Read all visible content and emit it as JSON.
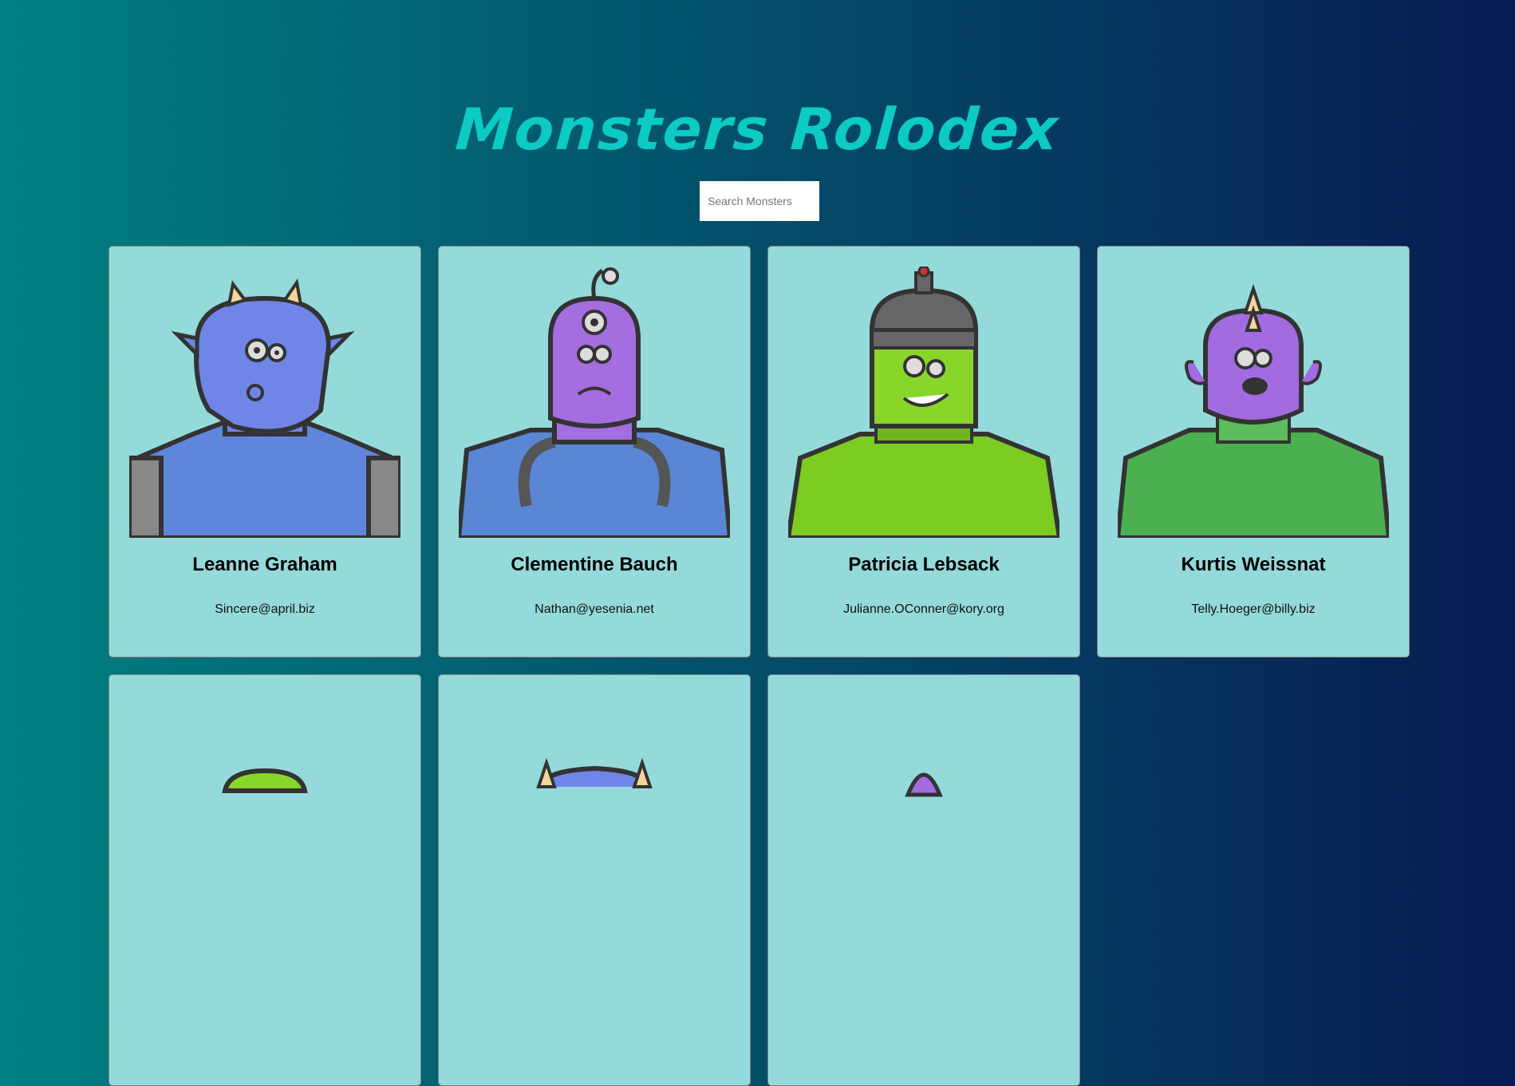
{
  "app": {
    "title": "Monsters Rolodex"
  },
  "search": {
    "placeholder": "Search Monsters",
    "value": ""
  },
  "monsters": [
    {
      "name": "Leanne Graham",
      "email": "Sincere@april.biz",
      "skin": "#6f86e8",
      "body": "#5f86dc",
      "accent": "#f1d59a",
      "type": "horns"
    },
    {
      "name": "Clementine Bauch",
      "email": "Nathan@yesenia.net",
      "skin": "#a46de0",
      "body": "#5a86d6",
      "accent": "#9a9a9a",
      "type": "cyclops"
    },
    {
      "name": "Patricia Lebsack",
      "email": "Julianne.OConner@kory.org",
      "skin": "#88d62a",
      "body": "#7ccc22",
      "accent": "#5d5d5d",
      "type": "helmet"
    },
    {
      "name": "Kurtis Weissnat",
      "email": "Telly.Hoeger@billy.biz",
      "skin": "#a26be0",
      "body": "#4caf50",
      "accent": "#f1d59a",
      "type": "spikes"
    },
    {
      "name": "",
      "email": "",
      "skin": "#88d62a",
      "body": "#5f86dc",
      "accent": "#f1d59a",
      "type": "partial"
    },
    {
      "name": "",
      "email": "",
      "skin": "#6f86e8",
      "body": "#5f86dc",
      "accent": "#f1d59a",
      "type": "partial-horns"
    },
    {
      "name": "",
      "email": "",
      "skin": "#a26be0",
      "body": "#5f86dc",
      "accent": "#f1d59a",
      "type": "partial"
    }
  ]
}
